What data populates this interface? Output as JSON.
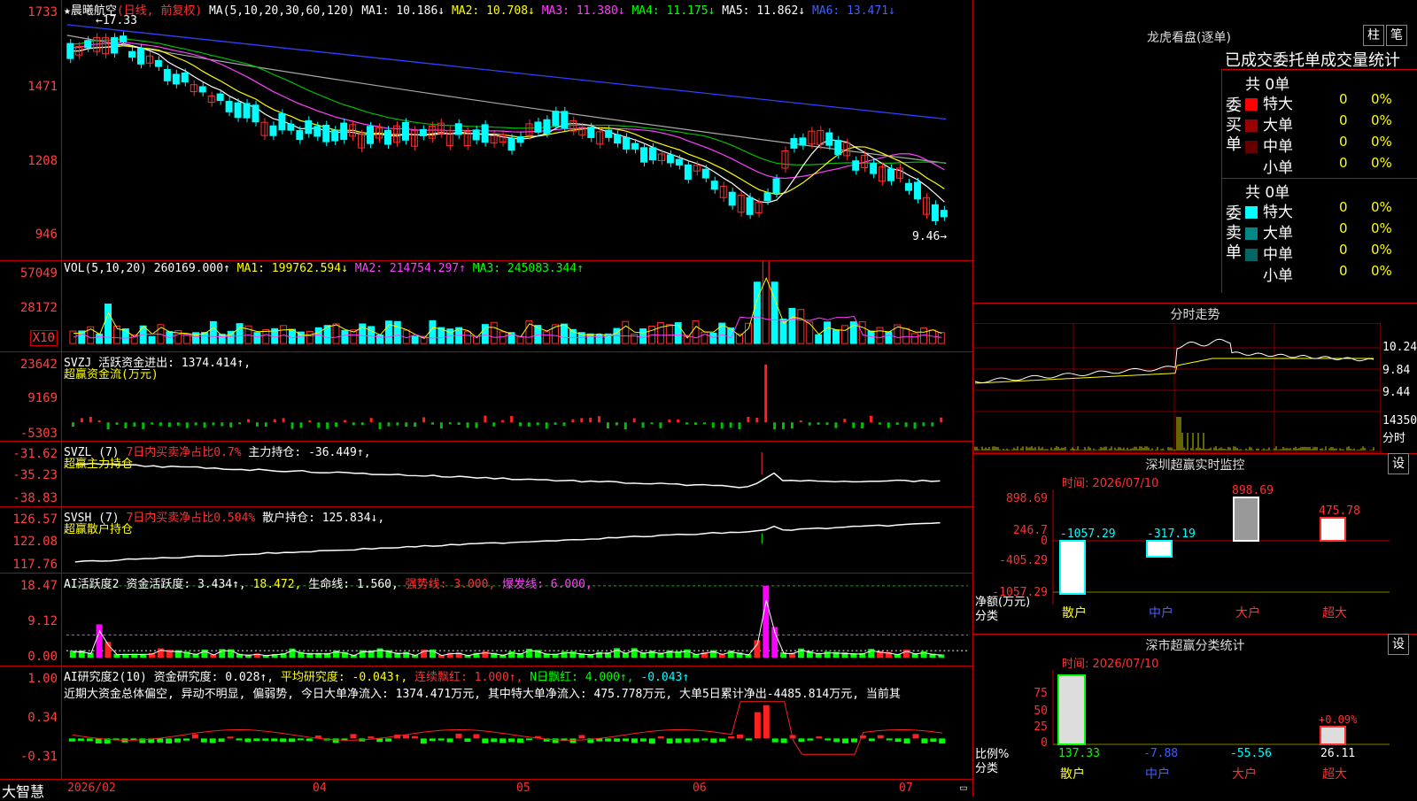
{
  "main": {
    "star": "★",
    "stock_name": "晨曦航空",
    "period": "(日线, 前复权)",
    "ma_label": "MA(5,10,20,30,60,120)",
    "ma1": "MA1: 10.186↓",
    "ma2": "MA2: 10.708↓",
    "ma3": "MA3: 11.380↓",
    "ma4": "MA4: 11.175↓",
    "ma5": "MA5: 11.862↓",
    "ma6": "MA6: 13.471↓",
    "high_mark": "←17.33",
    "low_mark": "9.46→",
    "y_ticks": [
      "1733",
      "1471",
      "1208",
      "946"
    ]
  },
  "vol": {
    "label": "VOL(5,10,20)",
    "value": "260169.000↑",
    "ma1": "MA1: 199762.594↓",
    "ma2": "MA2: 214754.297↑",
    "ma3": "MA3: 245083.344↑",
    "y_ticks": [
      "57049",
      "28172"
    ],
    "unit": "X10"
  },
  "svzj": {
    "label": "SVZJ",
    "active": "活跃资金进出: 1374.414↑,",
    "sub": "超赢资金流(万元)",
    "y_ticks": [
      "23642",
      "9169",
      "-5303"
    ]
  },
  "svzl": {
    "label": "SVZL (7)",
    "ratio": "7日内买卖净占比0.7%",
    "hold": "主力持仓: -36.449↑,",
    "sub": "超赢主力持仓",
    "y_ticks": [
      "-31.62",
      "-35.23",
      "-38.83"
    ]
  },
  "svsh": {
    "label": "SVSH (7)",
    "ratio": "7日内买卖净占比0.504%",
    "hold": "散户持仓: 125.834↓,",
    "sub": "超赢散户持仓",
    "y_ticks": [
      "126.57",
      "122.08",
      "117.76"
    ]
  },
  "ai1": {
    "label": "AI活跃度2",
    "act": "资金活跃度: 3.434↑,",
    "v2": "18.472,",
    "life": "生命线: 1.560,",
    "strong": "强势线: 3.000,",
    "burst": "爆发线: 6.000,",
    "y_ticks": [
      "18.47",
      "9.12",
      "0.00"
    ]
  },
  "ai2": {
    "label": "AI研究度2(10)",
    "res": "资金研究度: 0.028↑,",
    "avg": "平均研究度: -0.043↑,",
    "cont": "连续飘红: 1.000↑,",
    "nday": "N日飘红: 4.000↑,",
    "last": "-0.043↑",
    "text": "近期大资金总体偏空, 异动不明显, 偏弱势, 今日大单净流入: 1374.471万元, 其中特大单净流入: 475.778万元, 大单5日累计净出-4485.814万元, 当前其",
    "y_ticks": [
      "1.00",
      "0.34",
      "-0.31"
    ]
  },
  "bottom": {
    "brand": "大智慧",
    "dates": [
      "2026/02",
      "04",
      "05",
      "06",
      "07"
    ]
  },
  "dragon": {
    "title": "龙虎看盘(逐单)",
    "btn_bar": "柱",
    "btn_pen": "笔",
    "subtitle": "已成交委托单成交量统计",
    "buy_label": "委买单",
    "sell_label": "委卖单",
    "buy_total": "共 0单",
    "sell_total": "共 0单",
    "rows": [
      {
        "name": "特大",
        "count": "0",
        "pct": "0%"
      },
      {
        "name": "大单",
        "count": "0",
        "pct": "0%"
      },
      {
        "name": "中单",
        "count": "0",
        "pct": "0%"
      },
      {
        "name": "小单",
        "count": "0",
        "pct": "0%"
      }
    ],
    "buy_colors": [
      "#ff0000",
      "#990000",
      "#660000",
      "#000000"
    ],
    "sell_colors": [
      "#00ffff",
      "#008888",
      "#006666",
      "#000000"
    ]
  },
  "fenshi": {
    "title": "分时走势",
    "prices": [
      "10.24",
      "9.84",
      "9.44"
    ],
    "vol": "14350",
    "label": "分时"
  },
  "monitor": {
    "title": "深圳超赢实时监控",
    "btn": "设",
    "time": "时间: 2026/07/10",
    "y_ticks": [
      "898.69",
      "246.7",
      "0",
      "-405.29",
      "-1057.29"
    ],
    "values": [
      "-1057.29",
      "-317.19",
      "898.69",
      "475.78"
    ],
    "unit": "净额(万元)",
    "cls": "分类",
    "cats": [
      "散户",
      "中户",
      "大户",
      "超大"
    ]
  },
  "classify": {
    "title": "深市超赢分类统计",
    "btn": "设",
    "time": "时间: 2026/07/10",
    "y_ticks": [
      "75",
      "50",
      "25",
      "0"
    ],
    "pct": "+0.09%",
    "values": [
      "137.33",
      "-7.88",
      "-55.56",
      "26.11"
    ],
    "unit": "比例%",
    "cls": "分类",
    "cats": [
      "散户",
      "中户",
      "大户",
      "超大"
    ]
  }
}
